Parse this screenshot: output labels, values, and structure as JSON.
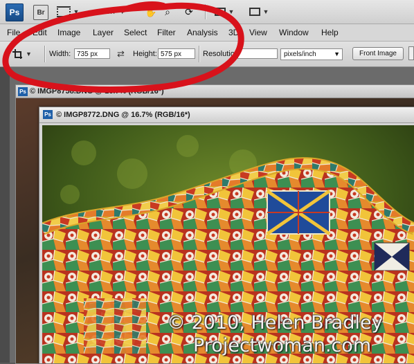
{
  "app": {
    "logo": "Ps",
    "bridge_label": "Br",
    "zoom_value": "16.7",
    "icons": [
      "photoshop-logo",
      "bridge-logo",
      "filmstrip-icon",
      "hand-icon",
      "zoom-icon",
      "rotate-view-icon",
      "arrange-documents-icon",
      "screen-mode-icon"
    ]
  },
  "menu": {
    "items": [
      "File",
      "Edit",
      "Image",
      "Layer",
      "Select",
      "Filter",
      "Analysis",
      "3D",
      "View",
      "Window",
      "Help"
    ]
  },
  "options": {
    "width_label": "Width:",
    "width_value": "735 px",
    "height_label": "Height:",
    "height_value": "575 px",
    "resolution_label": "Resolution:",
    "resolution_value": "",
    "resolution_unit": "pixels/inch",
    "front_image_label": "Front Image"
  },
  "documents": {
    "back_title": "© IMGP8758.DNG @ 16.7% (RGB/16*)",
    "front_title": "© IMGP8772.DNG @ 16.7% (RGB/16*)"
  },
  "watermark": {
    "line1": "© 2010, Helen Bradley",
    "line2": "Projectwoman.com"
  },
  "colors": {
    "annotation_red": "#d8121b",
    "ps_blue": "#1f5fa8"
  }
}
